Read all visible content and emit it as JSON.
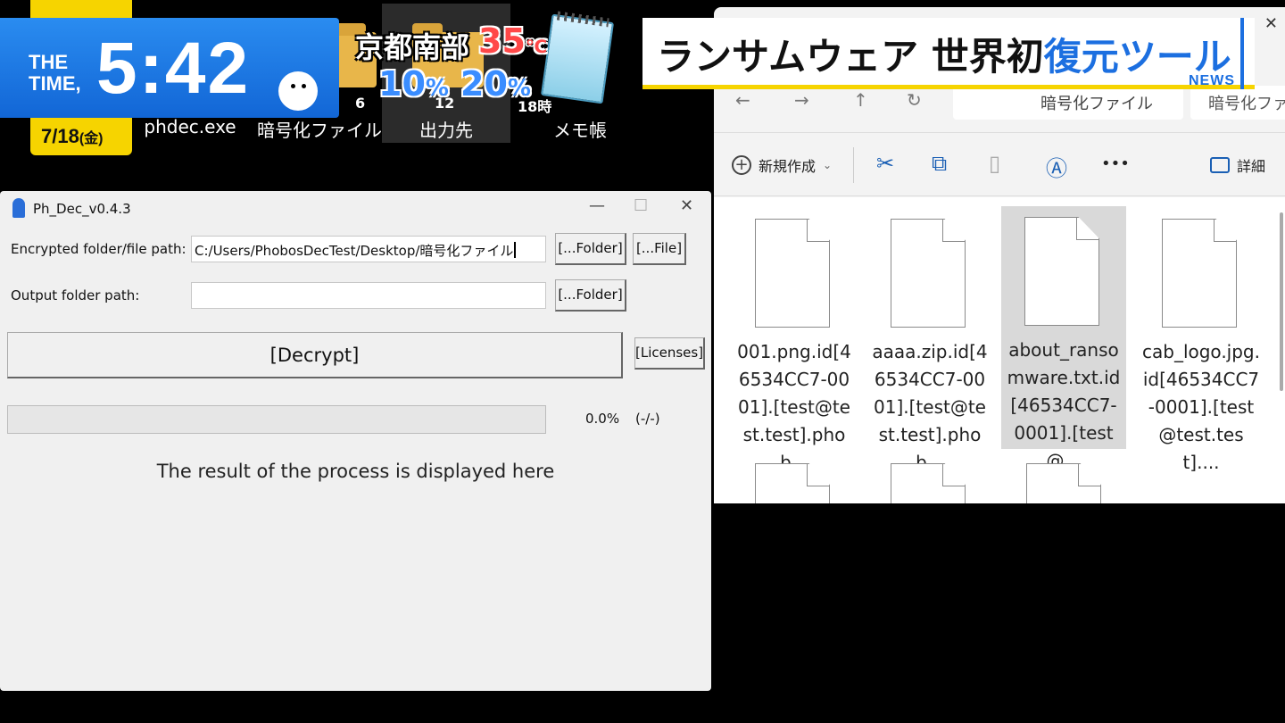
{
  "desktop": {
    "icons": [
      {
        "label": "phdec.exe"
      },
      {
        "label": "暗号化ファイル"
      },
      {
        "label": "出力先"
      },
      {
        "label": "メモ帳"
      }
    ]
  },
  "tv_overlay": {
    "brand_line1": "THE",
    "brand_line2": "TIME,",
    "clock": "5:42",
    "date": "7/18",
    "day_of_week": "(金)",
    "news_tag": "NEWS",
    "headline_main": "ランサムウェア 世界初",
    "headline_highlight": "復元ツール",
    "weather": {
      "place": "京都南部",
      "temperature": "35",
      "temp_unit": "℃",
      "precip_1": "10",
      "precip_1_hour": "6",
      "precip_2": "20",
      "precip_2_hour": "12",
      "precip_3_hour": "18時",
      "pct_unit": "%"
    },
    "colors": {
      "blue": "#1c6fe0",
      "yellow": "#f6d400",
      "red_temp": "#ff4848"
    }
  },
  "explorer": {
    "address": "暗号化ファイル",
    "search": "暗号化ファイ",
    "toolbar": {
      "new_label": "新規作成",
      "new_chevron": "⌄",
      "more": "•••",
      "details_label": "詳細"
    },
    "files": [
      {
        "name": "001.png.id[46534CC7-0001].[test@test.test].phob..."
      },
      {
        "name": "aaaa.zip.id[46534CC7-0001].[test@test.test].phob..."
      },
      {
        "name": "about_ransomware.txt.id[46534CC7-0001].[test@..."
      },
      {
        "name": "cab_logo.jpg.id[46534CC7-0001].[test@test.test]...."
      }
    ]
  },
  "phdec": {
    "title": "Ph_Dec_v0.4.3",
    "encrypted_label": "Encrypted folder/file path:",
    "encrypted_value": "C:/Users/PhobosDecTest/Desktop/暗号化ファイル",
    "output_label": "Output folder path:",
    "output_value": "",
    "folder_btn": "[...Folder]",
    "file_btn": "[...File]",
    "decrypt_btn": "[Decrypt]",
    "licenses_btn": "[Licenses]",
    "progress_fraction": 0.0,
    "progress_text": "0.0%",
    "count_text": "(-/-)",
    "result_text": "The result of the process is displayed here"
  }
}
